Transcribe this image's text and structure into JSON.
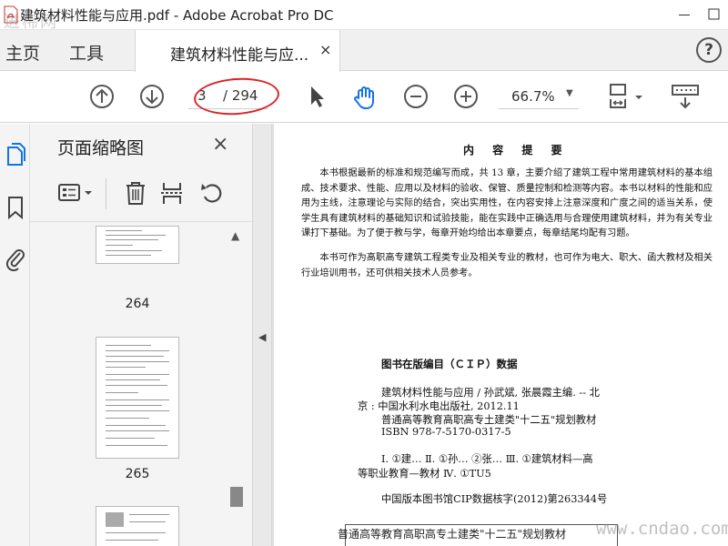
{
  "window": {
    "title": "建筑材料性能与应用.pdf - Adobe Acrobat Pro DC",
    "watermark_top": "进稀网"
  },
  "tabs": {
    "home": "主页",
    "tools": "工具",
    "document": "建筑材料性能与应...",
    "close": "×",
    "help": "?"
  },
  "toolbar": {
    "page_current": "3",
    "page_total": "/ 294",
    "zoom": "66.7%",
    "icons": [
      "arrow-up-circle-icon",
      "arrow-down-circle-icon",
      "cursor-icon",
      "hand-icon",
      "zoom-out-icon",
      "zoom-in-icon",
      "scroll-mode-icon",
      "keyboard-icon"
    ]
  },
  "sidebar": {
    "panel_title": "页面缩略图",
    "close": "×",
    "thumbnails": [
      {
        "page": "264"
      },
      {
        "page": "265"
      },
      {
        "page": ""
      }
    ]
  },
  "document": {
    "heading": "内 容 提 要",
    "paragraphs": [
      "本书根据最新的标准和规范编写而成，共 13 章，主要介绍了建筑工程中常用建筑材料的基本组成、技术要求、性能、应用以及材料的验收、保管、质量控制和检测等内容。本书以材料的性能和应用为主线，注意理论与实际的结合，突出实用性，在内容安排上注意深度和广度之间的适当关系，使学生具有建筑材料的基础知识和试验技能，能在实践中正确选用与合理使用建筑材料，并为有关专业课打下基础。为了便于教与学，每章开始均给出本章要点，每章结尾均配有习题。",
      "本书可作为高职高专建筑工程类专业及相关专业的教材，也可作为电大、职大、函大教材及相关行业培训用书，还可供相关技术人员参考。"
    ],
    "cip_title": "图书在版编目（ＣＩＰ）数据",
    "cip_lines": [
      "建筑材料性能与应用 / 孙武斌, 张晨霞主编. -- 北",
      "京 : 中国水利水电出版社, 2012.11",
      "普通高等教育高职高专土建类\"十二五\"规划教材",
      "ISBN 978-7-5170-0317-5",
      "Ⅰ. ①建… Ⅱ. ①孙… ②张… Ⅲ. ①建筑材料—高",
      "等职业教育—教材 Ⅳ. ①TU5",
      "中国版本图书馆CIP数据核字(2012)第263344号"
    ],
    "bottom_text": "普通高等教育高职高专土建类\"十二五\"规划教材"
  },
  "watermark_bottom": "www.cndao.com",
  "colors": {
    "annotation_red": "#d8262a",
    "acrobat_blue": "#1473e6"
  }
}
